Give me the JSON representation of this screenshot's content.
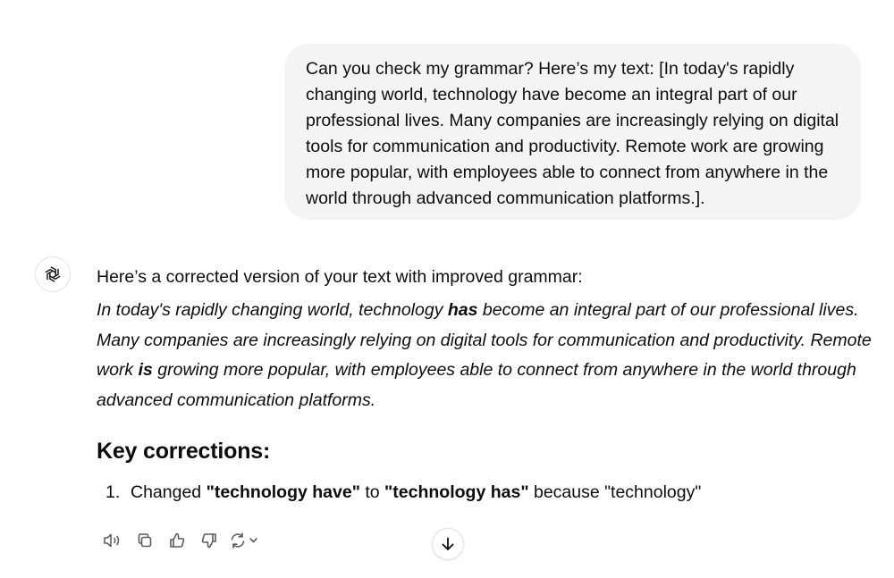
{
  "user_message": {
    "text": "Can you check my grammar? Here’s my text: [In today's rapidly changing world, technology have become an integral part of our professional lives. Many companies are increasingly relying on digital tools for communication and productivity. Remote work are growing more popular, with employees able to connect from anywhere in the world through advanced communication platforms.]."
  },
  "assistant": {
    "avatar_icon": "openai-logo-icon",
    "intro": "Here’s a corrected version of your text with improved grammar:",
    "corrected": {
      "p1": "In today's rapidly changing world, technology ",
      "b1": "has",
      "p2": " become an integral part of our professional lives. Many companies are increasingly relying on digital tools for communication and productivity. Remote work ",
      "b2": "is",
      "p3": " growing more popular, with employees able to connect from anywhere in the world through advanced communication platforms."
    },
    "heading": "Key corrections:",
    "corrections": [
      {
        "number": "1.",
        "pre": "Changed ",
        "from": "\"technology have\"",
        "mid": " to ",
        "to": "\"technology has\"",
        "post": " because \"technology\""
      }
    ]
  },
  "actions": {
    "icons": [
      "read-aloud-icon",
      "copy-icon",
      "thumbs-up-icon",
      "thumbs-down-icon",
      "regenerate-icon"
    ]
  },
  "scroll_button": {
    "icon": "arrow-down-icon"
  }
}
